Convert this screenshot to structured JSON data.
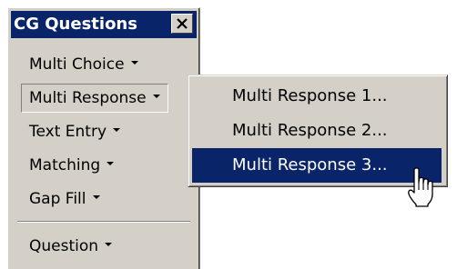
{
  "window": {
    "title": "CG Questions",
    "close_icon": "close-icon"
  },
  "toolbar": {
    "items": [
      {
        "label": "Multi Choice",
        "icon": "dropdown-arrow-icon",
        "pressed": false
      },
      {
        "label": "Multi Response",
        "icon": "dropdown-arrow-icon",
        "pressed": true
      },
      {
        "label": "Text Entry",
        "icon": "dropdown-arrow-icon",
        "pressed": false
      },
      {
        "label": "Matching",
        "icon": "dropdown-arrow-icon",
        "pressed": false
      },
      {
        "label": "Gap Fill",
        "icon": "dropdown-arrow-icon",
        "pressed": false
      },
      {
        "label": "Question",
        "icon": "dropdown-arrow-icon",
        "pressed": false
      }
    ]
  },
  "menu": {
    "items": [
      {
        "label": "Multi Response 1...",
        "selected": false
      },
      {
        "label": "Multi Response 2...",
        "selected": false
      },
      {
        "label": "Multi Response 3...",
        "selected": true
      }
    ]
  },
  "colors": {
    "titlebar": "#0a246a",
    "face": "#d4d0c8",
    "highlight": "#0a246a"
  },
  "cursor": "hand-pointer-cursor"
}
